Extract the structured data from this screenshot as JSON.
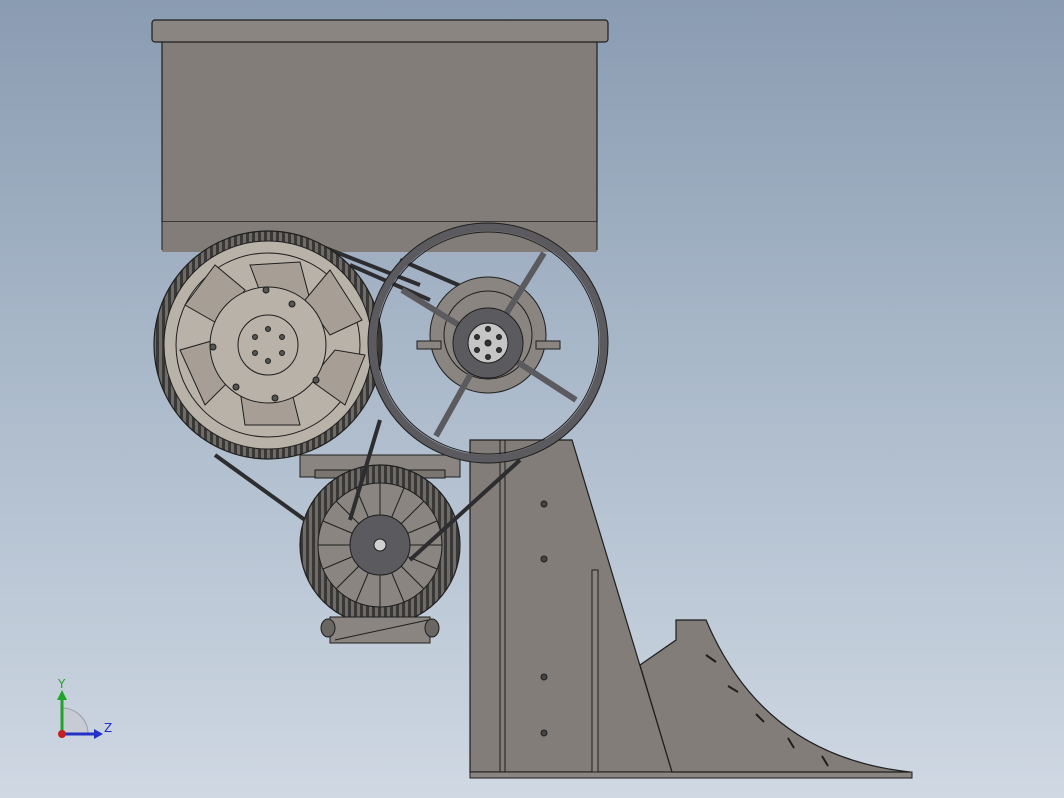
{
  "viewport": {
    "background_top": "#8a9cb2",
    "background_bottom": "#cfd8e3",
    "model_fill": "#827d78",
    "edge_color": "#1e1e1e",
    "pulley_light_fill": "#b9b2a8",
    "pulley_dark_fill": "#5b5a5f"
  },
  "triad": {
    "y_label": "Y",
    "z_label": "Z",
    "y_color": "#22a32a",
    "z_color": "#2230c8",
    "x_color": "#c42020"
  }
}
